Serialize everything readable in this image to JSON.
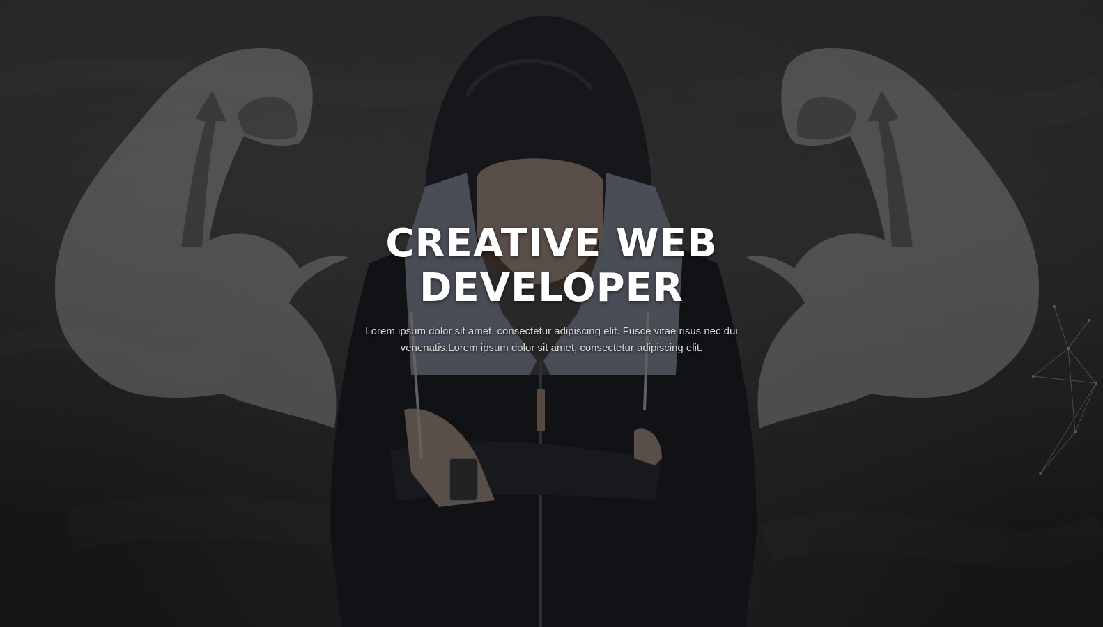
{
  "hero": {
    "title_line1": "CREATIVE WEB",
    "title_line2": "DEVELOPER",
    "description": "Lorem ipsum dolor sit amet, consectetur adipiscing elit. Fusce vitae risus nec dui venenatis.Lorem ipsum dolor sit amet, consectetur adipiscing elit."
  },
  "colors": {
    "background": "#1c1c1c",
    "title": "#ffffff",
    "text": "#dcdcdc",
    "chalk": "#8a8a8a"
  }
}
